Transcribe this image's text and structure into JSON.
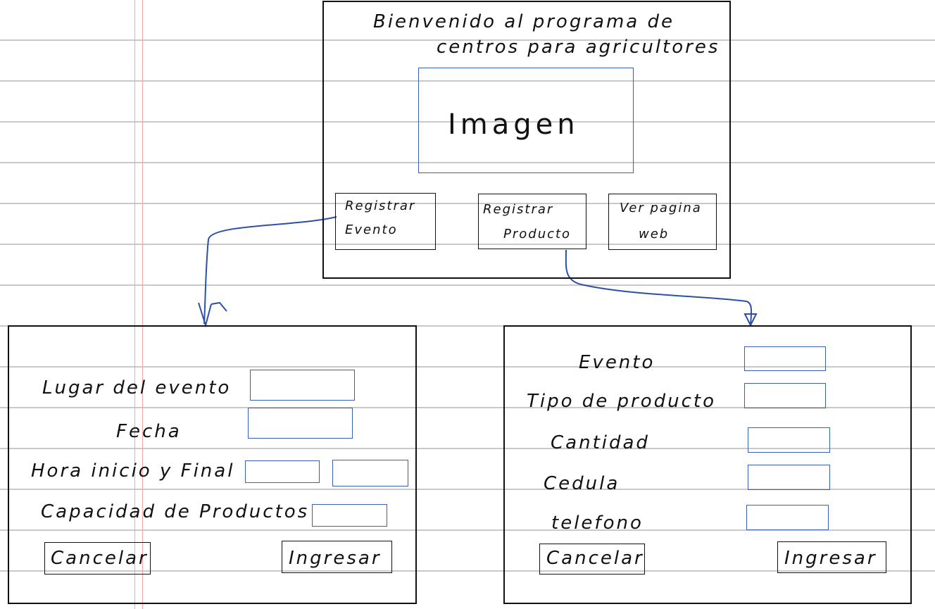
{
  "main": {
    "title_line1": "Bienvenido al programa de",
    "title_line2": "centros para agricultores",
    "image_label": "Imagen",
    "buttons": {
      "register_event_line1": "Registrar",
      "register_event_line2": "Evento",
      "register_product_line1": "Registrar",
      "register_product_line2": "Producto",
      "view_web_line1": "Ver pagina",
      "view_web_line2": "web"
    }
  },
  "event_form": {
    "place_label": "Lugar del evento",
    "date_label": "Fecha",
    "time_label": "Hora inicio y Final",
    "capacity_label": "Capacidad de Productos",
    "cancel_label": "Cancelar",
    "submit_label": "Ingresar"
  },
  "product_form": {
    "event_label": "Evento",
    "product_type_label": "Tipo de producto",
    "quantity_label": "Cantidad",
    "id_label": "Cedula",
    "phone_label": "telefono",
    "cancel_label": "Cancelar",
    "submit_label": "Ingresar"
  },
  "colors": {
    "ink": "#111111",
    "blue_ink": "#3a5fb8",
    "notebook_line": "#c9c9c9",
    "margin_line": "#f2a6a6"
  }
}
